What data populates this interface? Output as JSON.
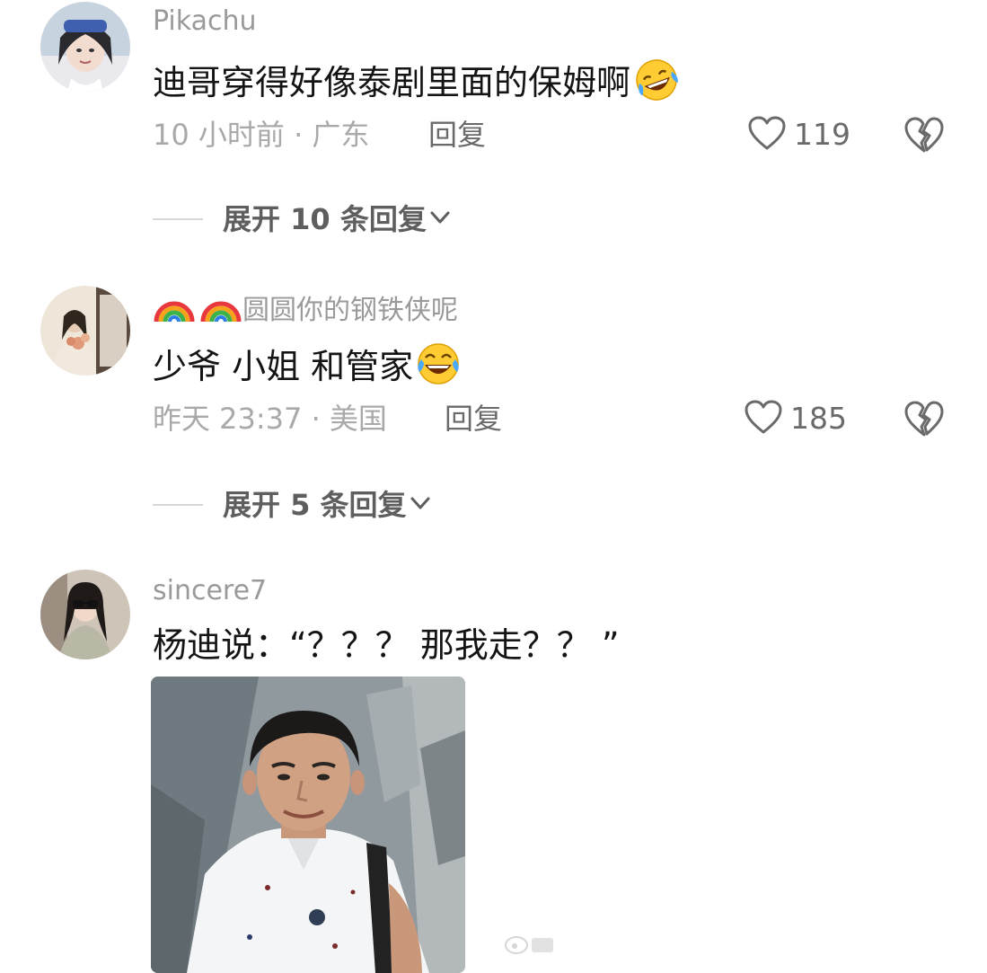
{
  "comments": [
    {
      "username": "Pikachu",
      "text": "迪哥穿得好像泰剧里面的保姆啊",
      "emoji": "rofl-emoji",
      "meta": "10 小时前 · 广东",
      "reply_label": "回复",
      "likes": "119",
      "expand_label": "展开 10 条回复"
    },
    {
      "username_prefix_icons": [
        "rainbow-icon",
        "rainbow-icon"
      ],
      "username": "圆圆你的钢铁侠呢",
      "text": "少爷 小姐 和管家",
      "emoji": "laugh-cry-emoji",
      "meta": "昨天 23:37 · 美国",
      "reply_label": "回复",
      "likes": "185",
      "expand_label": "展开 5 条回复"
    },
    {
      "username": "sincere7",
      "text": "杨迪说：“？？？ 那我走？？ ”",
      "image": "meme-photo"
    }
  ],
  "colors": {
    "username": "#9a9a9a",
    "body_text": "#141414",
    "meta": "#a9a9a9",
    "action": "#6a6a6a"
  }
}
